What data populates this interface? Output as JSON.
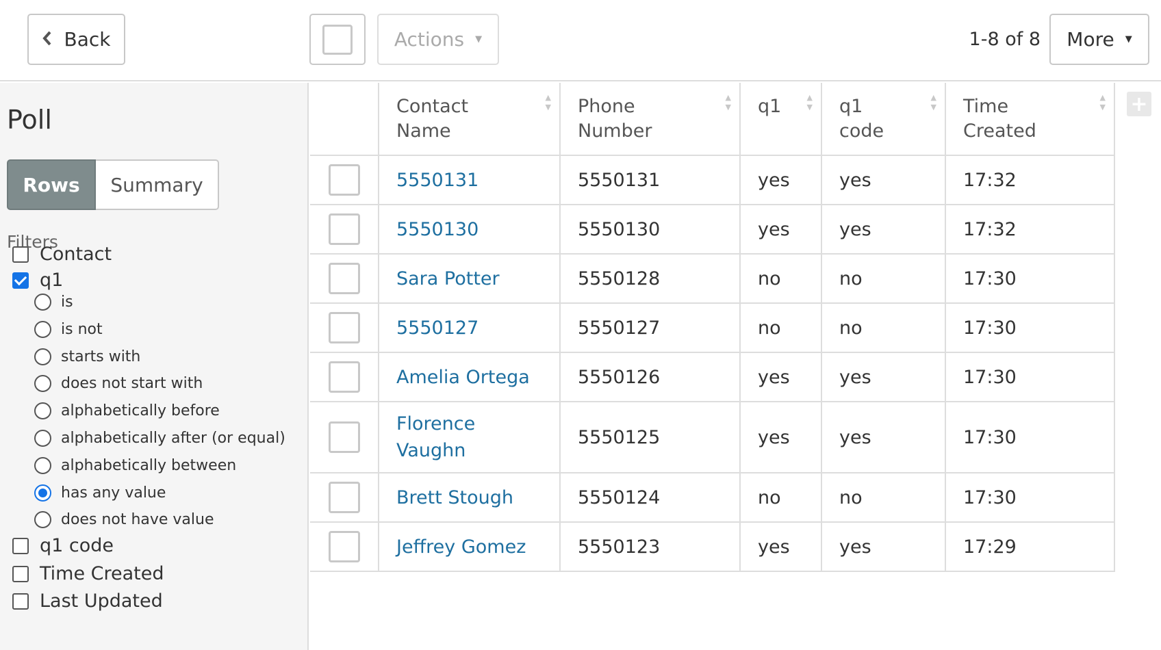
{
  "toolbar": {
    "back_label": "Back",
    "actions_label": "Actions",
    "count_label": "1-8 of 8",
    "more_label": "More"
  },
  "sidebar": {
    "title": "Poll",
    "tabs": {
      "rows": "Rows",
      "summary": "Summary",
      "active": "Rows"
    },
    "filters_label": "Filters",
    "filters": [
      {
        "label": "Contact",
        "checked": false
      },
      {
        "label": "q1",
        "checked": true
      },
      {
        "label": "q1 code",
        "checked": false
      },
      {
        "label": "Time Created",
        "checked": false
      },
      {
        "label": "Last Updated",
        "checked": false
      }
    ],
    "q1_options": [
      {
        "label": "is",
        "selected": false
      },
      {
        "label": "is not",
        "selected": false
      },
      {
        "label": "starts with",
        "selected": false
      },
      {
        "label": "does not start with",
        "selected": false
      },
      {
        "label": "alphabetically before",
        "selected": false
      },
      {
        "label": "alphabetically after (or equal)",
        "selected": false
      },
      {
        "label": "alphabetically between",
        "selected": false
      },
      {
        "label": "has any value",
        "selected": true
      },
      {
        "label": "does not have value",
        "selected": false
      }
    ]
  },
  "table": {
    "headers": {
      "contact_name": [
        "Contact",
        "Name"
      ],
      "phone_number": [
        "Phone",
        "Number"
      ],
      "q1": [
        "q1",
        ""
      ],
      "q1_code": [
        "q1",
        "code"
      ],
      "time_created": [
        "Time",
        "Created"
      ]
    },
    "rows": [
      {
        "contact_name": "5550131",
        "phone_number": "5550131",
        "q1": "yes",
        "q1_code": "yes",
        "time_created": "17:32"
      },
      {
        "contact_name": "5550130",
        "phone_number": "5550130",
        "q1": "yes",
        "q1_code": "yes",
        "time_created": "17:32"
      },
      {
        "contact_name": "Sara Potter",
        "phone_number": "5550128",
        "q1": "no",
        "q1_code": "no",
        "time_created": "17:30"
      },
      {
        "contact_name": "5550127",
        "phone_number": "5550127",
        "q1": "no",
        "q1_code": "no",
        "time_created": "17:30"
      },
      {
        "contact_name": "Amelia Ortega",
        "phone_number": "5550126",
        "q1": "yes",
        "q1_code": "yes",
        "time_created": "17:30"
      },
      {
        "contact_name": "Florence Vaughn",
        "phone_number": "5550125",
        "q1": "yes",
        "q1_code": "yes",
        "time_created": "17:30"
      },
      {
        "contact_name": "Brett Stough",
        "phone_number": "5550124",
        "q1": "no",
        "q1_code": "no",
        "time_created": "17:30"
      },
      {
        "contact_name": "Jeffrey Gomez",
        "phone_number": "5550123",
        "q1": "yes",
        "q1_code": "yes",
        "time_created": "17:29"
      }
    ]
  },
  "colors": {
    "link": "#1e6fa0",
    "active_tab": "#7f8c8d",
    "check_accent": "#1473e6"
  }
}
